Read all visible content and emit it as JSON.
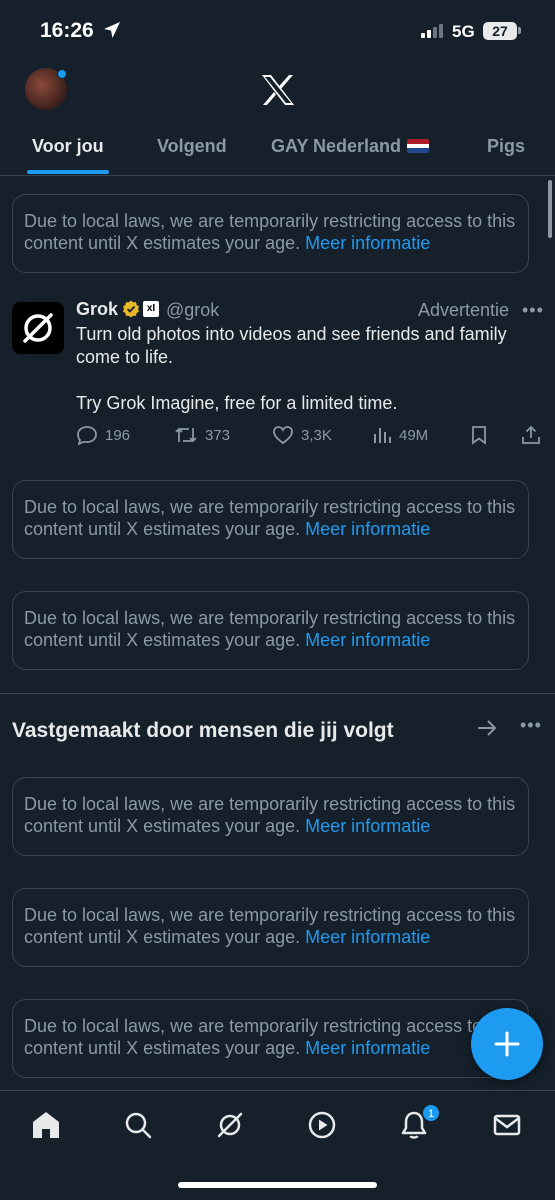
{
  "status_bar": {
    "time": "16:26",
    "network": "5G",
    "battery": "27"
  },
  "tabs": [
    {
      "label": "Voor jou"
    },
    {
      "label": "Volgend"
    },
    {
      "label": "GAY Nederland"
    },
    {
      "label": "Pigs"
    }
  ],
  "notice": {
    "text": "Due to local laws, we are temporarily restricting access to this content until X estimates your age.",
    "link": "Meer informatie"
  },
  "ad_tweet": {
    "name": "Grok",
    "badge": "xI",
    "handle": "@grok",
    "ad_label": "Advertentie",
    "line1": "Turn old photos into videos and see friends and family come to life.",
    "line2": "Try Grok Imagine, free for a limited time.",
    "replies": "196",
    "reposts": "373",
    "likes": "3,3K",
    "views": "49M"
  },
  "section": {
    "title": "Vastgemaakt door mensen die jij volgt"
  },
  "bottom_nav": {
    "notification_count": "1"
  },
  "colors": {
    "background": "#15202b",
    "accent": "#1d9bf0",
    "muted": "#8b98a5",
    "border": "#38444d"
  }
}
